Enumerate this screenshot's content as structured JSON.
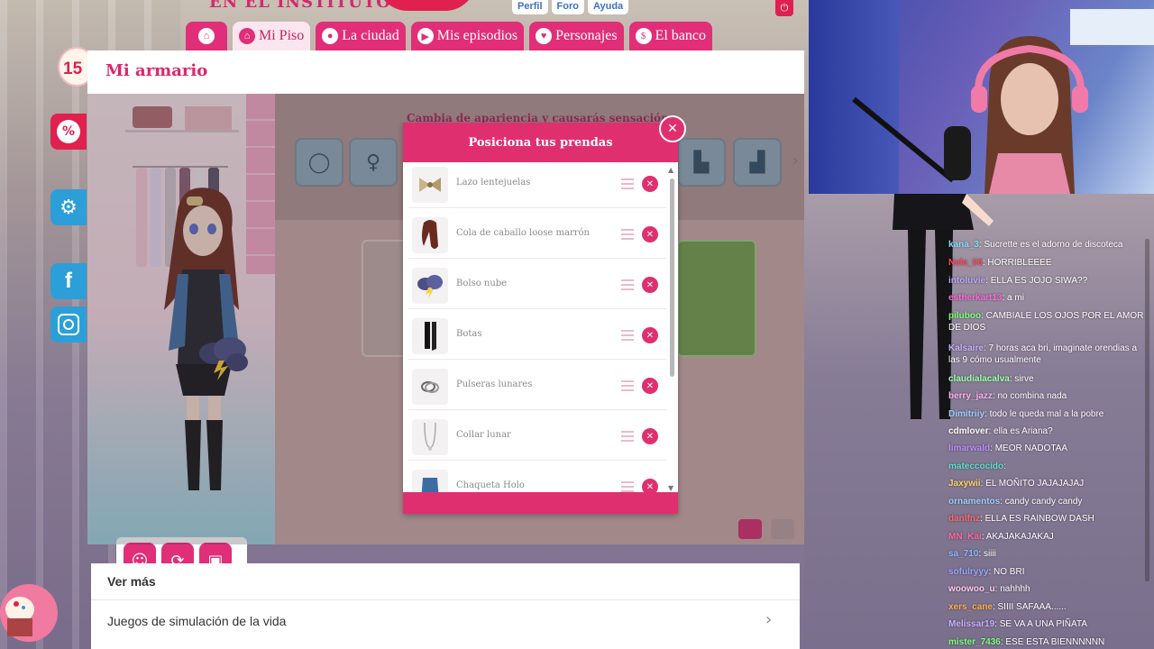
{
  "game": {
    "logo_text": "EN EL INSTITUTO",
    "top_links": [
      "Perfil",
      "Foro",
      "Ayuda"
    ],
    "nav_tabs": [
      {
        "label": "Mi Piso",
        "icon": "house-icon",
        "active": true
      },
      {
        "label": "La ciudad",
        "icon": "pin-icon",
        "active": false
      },
      {
        "label": "Mis episodios",
        "icon": "play-icon",
        "active": false
      },
      {
        "label": "Personajes",
        "icon": "heart-icon",
        "active": false
      },
      {
        "label": "El banco",
        "icon": "bank-icon",
        "active": false
      }
    ],
    "gift_badge_number": "15",
    "side_buttons": [
      {
        "name": "discount-icon",
        "symbol": "%",
        "color": "#e0204f"
      },
      {
        "name": "gear-icon",
        "symbol": "⚙",
        "color": "#2c9fd8"
      },
      {
        "name": "facebook-icon",
        "symbol": "f",
        "color": "#2c9fd8"
      },
      {
        "name": "instagram-icon",
        "symbol": "◎",
        "color": "#2c9fd8"
      }
    ]
  },
  "armario": {
    "title": "Mi armario",
    "subtitle": "Cambia de apariencia y causarás sensación",
    "category_icons": [
      "ring-icon",
      "hair-icon",
      "sock-icon",
      "boot-icon"
    ]
  },
  "modal": {
    "title": "Posiciona tus prendas",
    "items": [
      {
        "label": "Lazo lentejuelas",
        "icon": "bow-icon"
      },
      {
        "label": "Cola de caballo loose marrón",
        "icon": "hair-icon"
      },
      {
        "label": "Bolso nube",
        "icon": "cloud-icon"
      },
      {
        "label": "Botas",
        "icon": "boots-icon"
      },
      {
        "label": "Pulseras lunares",
        "icon": "bracelet-icon"
      },
      {
        "label": "Collar lunar",
        "icon": "necklace-icon"
      },
      {
        "label": "Chaqueta Holo",
        "icon": "jacket-icon"
      }
    ]
  },
  "ver_mas": {
    "title": "Ver más",
    "item": "Juegos de simulación de la vida"
  },
  "chat": [
    {
      "user": "kana_3",
      "color": "#7fe0ff",
      "msg": "Sucrette es el adorno de discoteca"
    },
    {
      "user": "Nala_06",
      "color": "#ff4b5c",
      "msg": "HORRIBLEEEE"
    },
    {
      "user": "intoluvie",
      "color": "#b9a6ff",
      "msg": "ELLA ES JOJO SIWA??"
    },
    {
      "user": "estherkart13",
      "color": "#ff6ad5",
      "msg": "a mi"
    },
    {
      "user": "piluboo",
      "color": "#7dff7d",
      "msg": "CAMBIALE LOS OJOS POR EL AMOR DE DIOS"
    },
    {
      "user": "Kalsaire",
      "color": "#c8b0ff",
      "msg": "7 horas aca bri, imaginate orendias a las 9 cómo usualmente"
    },
    {
      "user": "claudialacalva",
      "color": "#9effa8",
      "msg": "sirve"
    },
    {
      "user": "berry_jazz",
      "color": "#ffb0f0",
      "msg": "no combina nada"
    },
    {
      "user": "Dimitriiy",
      "color": "#9fd0ff",
      "msg": "todo le queda mal a la pobre"
    },
    {
      "user": "cdmlover",
      "color": "#ffffff",
      "msg": "ella es Ariana?"
    },
    {
      "user": "limarwald",
      "color": "#c08fff",
      "msg": "MEOR NADOTAA"
    },
    {
      "user": "mateccocido",
      "color": "#5fe0d0",
      "msg": ""
    },
    {
      "user": "Jaxywii",
      "color": "#ffd36b",
      "msg": "EL MOÑITO JAJAJAJAJ"
    },
    {
      "user": "ornamentos",
      "color": "#9fd0ff",
      "msg": "candy candy candy"
    },
    {
      "user": "danlfnz",
      "color": "#ff6b6b",
      "msg": "ELLA ES RAINBOW DASH"
    },
    {
      "user": "MN_Kai",
      "color": "#ff6b9a",
      "msg": "AKAJAKAJAKAJ"
    },
    {
      "user": "sa_710",
      "color": "#8fb8ff",
      "msg": "siiii"
    },
    {
      "user": "sofulryyy",
      "color": "#9aa6ff",
      "msg": "NO BRI"
    },
    {
      "user": "woowoo_u",
      "color": "#ffc8e8",
      "msg": "nahhhh"
    },
    {
      "user": "xers_cane",
      "color": "#ffb04b",
      "msg": "SIIII SAFAAA......"
    },
    {
      "user": "Melissar19",
      "color": "#c8b0ff",
      "msg": "SE VA A UNA PIÑATA"
    },
    {
      "user": "mister_7436",
      "color": "#7dff7d",
      "msg": "ESE ESTA BIENNNNNN"
    }
  ]
}
